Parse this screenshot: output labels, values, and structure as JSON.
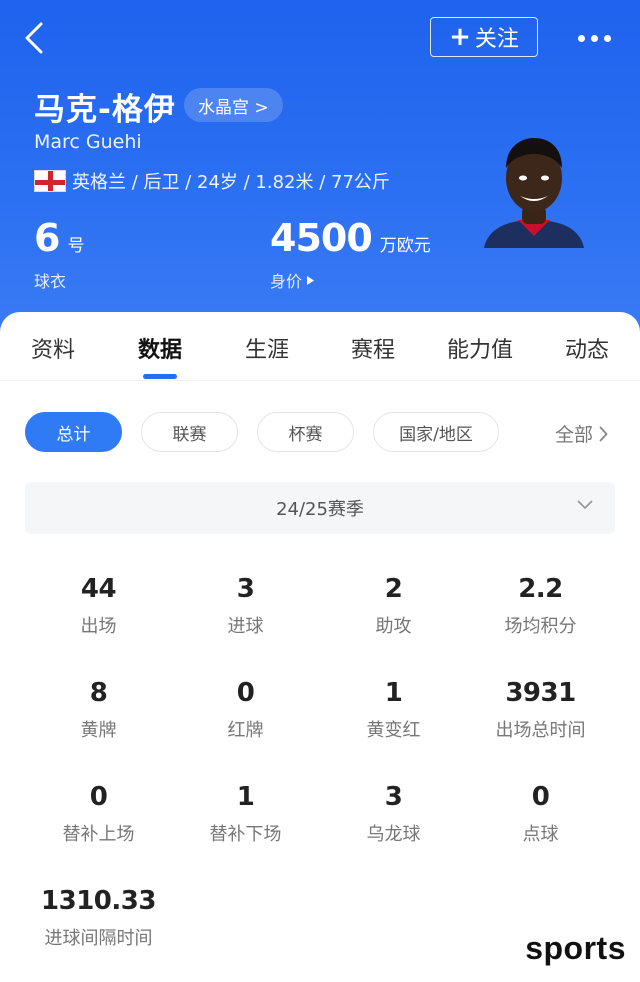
{
  "header": {
    "follow_label": "关注",
    "name_cn": "马克-格伊",
    "club": "水晶宫 >",
    "name_en": "Marc Guehi",
    "info": "英格兰 / 后卫 / 24岁 / 1.82米 / 77公斤",
    "shirt_number": "6",
    "shirt_unit": "号",
    "shirt_caption": "球衣",
    "value": "4500",
    "value_unit": "万欧元",
    "value_caption": "身价",
    "icons": {
      "back": "chevron-left-icon",
      "more": "more-dots-icon",
      "flag": "england-flag-icon",
      "play": "triangle-right-icon"
    }
  },
  "tabs": [
    {
      "label": "资料"
    },
    {
      "label": "数据",
      "active": true
    },
    {
      "label": "生涯"
    },
    {
      "label": "赛程"
    },
    {
      "label": "能力值"
    },
    {
      "label": "动态"
    }
  ],
  "filters": {
    "chips": [
      {
        "label": "总计",
        "active": true
      },
      {
        "label": "联赛"
      },
      {
        "label": "杯赛"
      },
      {
        "label": "国家/地区"
      }
    ],
    "all_label": "全部"
  },
  "season": {
    "label": "24/25赛季"
  },
  "stats": [
    {
      "value": "44",
      "label": "出场"
    },
    {
      "value": "3",
      "label": "进球"
    },
    {
      "value": "2",
      "label": "助攻"
    },
    {
      "value": "2.2",
      "label": "场均积分"
    },
    {
      "value": "8",
      "label": "黄牌"
    },
    {
      "value": "0",
      "label": "红牌"
    },
    {
      "value": "1",
      "label": "黄变红"
    },
    {
      "value": "3931",
      "label": "出场总时间"
    },
    {
      "value": "0",
      "label": "替补上场"
    },
    {
      "value": "1",
      "label": "替补下场"
    },
    {
      "value": "3",
      "label": "乌龙球"
    },
    {
      "value": "0",
      "label": "点球"
    },
    {
      "value": "1310.33",
      "label": "进球间隔时间"
    }
  ],
  "watermark": "sports",
  "colors": {
    "primary": "#2a6cf0",
    "header_top": "#1f63ee",
    "chip_active": "#2f7bf6"
  }
}
